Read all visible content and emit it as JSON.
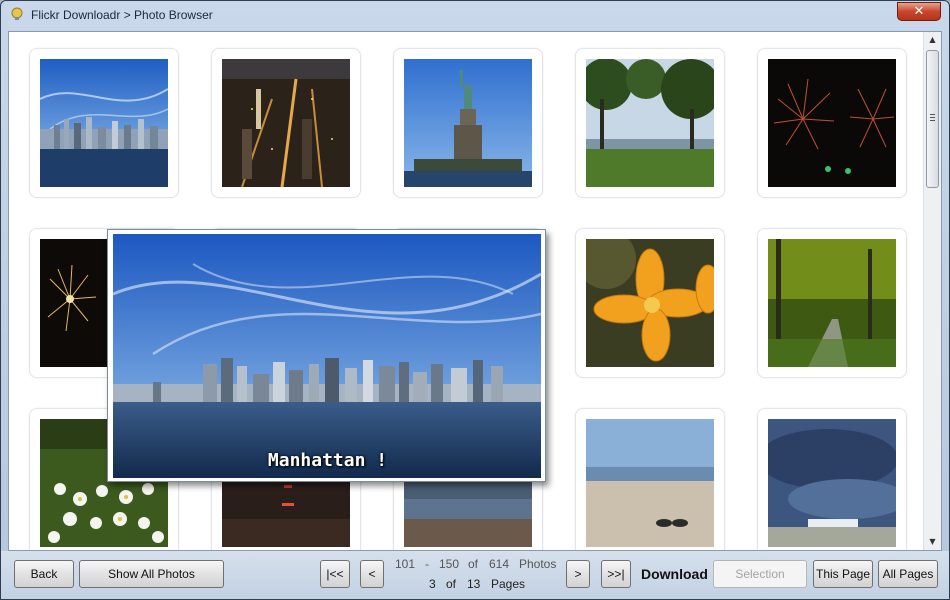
{
  "window": {
    "title": "Flickr Downloadr > Photo Browser",
    "app_icon": "flickr-downloadr-icon",
    "close_label": "✕"
  },
  "gallery": {
    "photos": [
      {
        "icon": "manhattan-skyline-photo"
      },
      {
        "icon": "city-night-photo"
      },
      {
        "icon": "statue-of-liberty-photo"
      },
      {
        "icon": "park-trees-photo"
      },
      {
        "icon": "fireworks-photo"
      },
      {
        "icon": "fireworks-small-photo"
      },
      {
        "icon": "hidden-photo"
      },
      {
        "icon": "hidden-photo"
      },
      {
        "icon": "orange-lily-photo"
      },
      {
        "icon": "forest-path-photo"
      },
      {
        "icon": "white-daisies-photo"
      },
      {
        "icon": "sunset-water-photo"
      },
      {
        "icon": "beach-clouds-photo"
      },
      {
        "icon": "sandals-beach-photo"
      },
      {
        "icon": "stormy-sky-photo"
      }
    ],
    "preview": {
      "caption": "Manhattan !",
      "icon": "manhattan-skyline-large-photo"
    }
  },
  "toolbar": {
    "back_label": "Back",
    "show_all_label": "Show All Photos",
    "first_label": "|<<",
    "prev_label": "<",
    "next_label": ">",
    "last_label": ">>|",
    "range_start": "101",
    "range_dash": "-",
    "range_end": "150",
    "of_label": "of",
    "total_photos": "614",
    "photos_label": "Photos",
    "current_page": "3",
    "page_of_label": "of",
    "total_pages": "13",
    "pages_label": "Pages",
    "download_label": "Download",
    "selection_label": "Selection",
    "this_page_label": "This Page",
    "all_pages_label": "All Pages"
  },
  "colors": {
    "titlebar": "#c9d8ea",
    "close": "#c8462c",
    "toolbar": "#c2d1e3"
  }
}
